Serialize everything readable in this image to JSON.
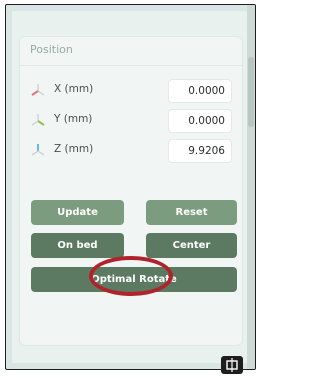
{
  "position_panel": {
    "title": "Position",
    "rows": [
      {
        "label": "X (mm)",
        "value": "0.0000",
        "icon": "axis-x-icon",
        "color": "#e57373"
      },
      {
        "label": "Y (mm)",
        "value": "0.0000",
        "icon": "axis-y-icon",
        "color": "#8bc34a"
      },
      {
        "label": "Z (mm)",
        "value": "9.9206",
        "icon": "axis-z-icon",
        "color": "#64b5f6"
      }
    ],
    "buttons": {
      "update": "Update",
      "reset": "Reset",
      "on_bed": "On bed",
      "center": "Center",
      "optimal_rotate": "Optimal Rotate"
    }
  },
  "colors": {
    "accent_light": "#7c9c7f",
    "accent_dark": "#5b7a61",
    "annotation": "#b1232a"
  }
}
